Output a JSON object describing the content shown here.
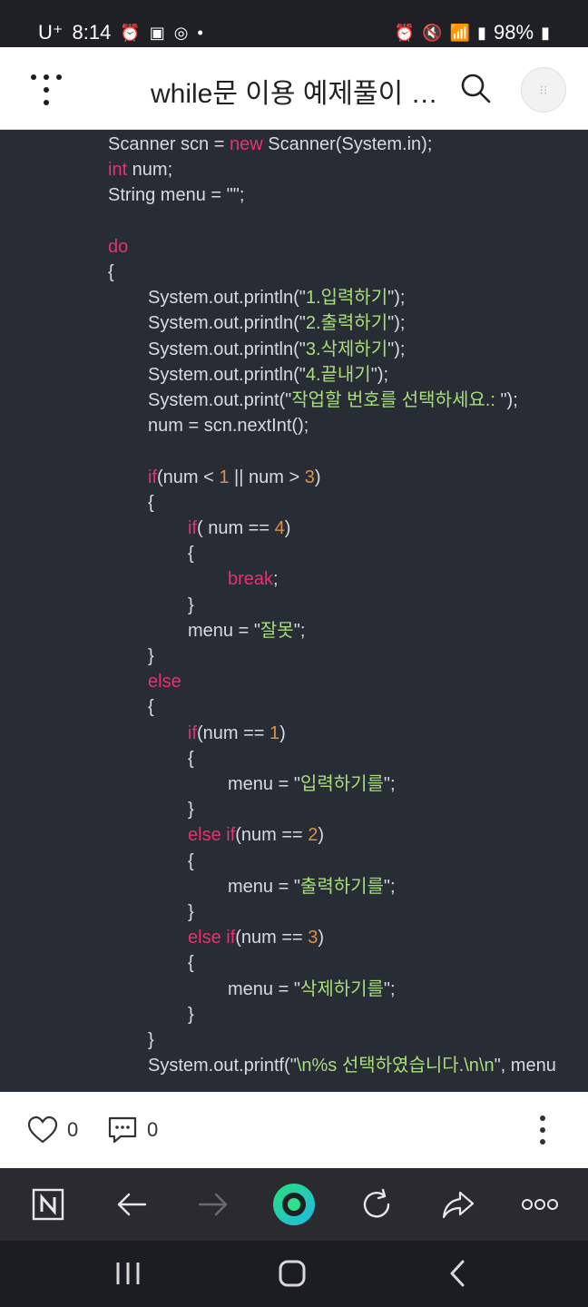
{
  "status_bar": {
    "carrier": "U⁺",
    "time": "8:14",
    "battery": "98%"
  },
  "header": {
    "title": "while문 이용 예제풀이 …"
  },
  "code_lines": [
    [
      [
        "plain",
        "Scanner scn = "
      ],
      [
        "kw",
        "new"
      ],
      [
        "plain",
        " Scanner(System.in);"
      ]
    ],
    [
      [
        "kw",
        "int"
      ],
      [
        "plain",
        " num;"
      ]
    ],
    [
      [
        "plain",
        "String menu = \"\";"
      ]
    ],
    [],
    [
      [
        "kw",
        "do"
      ]
    ],
    [
      [
        "plain",
        "{"
      ]
    ],
    [
      [
        "plain",
        "System.out.println(\""
      ],
      [
        "str",
        "1.입력하기"
      ],
      [
        "plain",
        "\");"
      ]
    ],
    [
      [
        "plain",
        "System.out.println(\""
      ],
      [
        "str",
        "2.출력하기"
      ],
      [
        "plain",
        "\");"
      ]
    ],
    [
      [
        "plain",
        "System.out.println(\""
      ],
      [
        "str",
        "3.삭제하기"
      ],
      [
        "plain",
        "\");"
      ]
    ],
    [
      [
        "plain",
        "System.out.println(\""
      ],
      [
        "str",
        "4.끝내기"
      ],
      [
        "plain",
        "\");"
      ]
    ],
    [
      [
        "plain",
        "System.out.print(\""
      ],
      [
        "str",
        "작업할 번호를 선택하세요.: "
      ],
      [
        "plain",
        "\");"
      ]
    ],
    [
      [
        "plain",
        "num = scn.nextInt();"
      ]
    ],
    [],
    [
      [
        "kw",
        "if"
      ],
      [
        "plain",
        "(num < "
      ],
      [
        "num",
        "1"
      ],
      [
        "plain",
        " || num > "
      ],
      [
        "num",
        "3"
      ],
      [
        "plain",
        ")"
      ]
    ],
    [
      [
        "plain",
        "{"
      ]
    ],
    [
      [
        "kw",
        "if"
      ],
      [
        "plain",
        "( num == "
      ],
      [
        "num",
        "4"
      ],
      [
        "plain",
        ")"
      ]
    ],
    [
      [
        "plain",
        "{"
      ]
    ],
    [
      [
        "kw",
        "break"
      ],
      [
        "plain",
        ";"
      ]
    ],
    [
      [
        "plain",
        "}"
      ]
    ],
    [
      [
        "plain",
        "menu = \""
      ],
      [
        "str",
        "잘못"
      ],
      [
        "plain",
        "\";"
      ]
    ],
    [
      [
        "plain",
        "}"
      ]
    ],
    [
      [
        "kw",
        "else"
      ]
    ],
    [
      [
        "plain",
        "{"
      ]
    ],
    [
      [
        "kw",
        "if"
      ],
      [
        "plain",
        "(num == "
      ],
      [
        "num",
        "1"
      ],
      [
        "plain",
        ")"
      ]
    ],
    [
      [
        "plain",
        "{"
      ]
    ],
    [
      [
        "plain",
        "menu = \""
      ],
      [
        "str",
        "입력하기를"
      ],
      [
        "plain",
        "\";"
      ]
    ],
    [
      [
        "plain",
        "}"
      ]
    ],
    [
      [
        "kw",
        "else if"
      ],
      [
        "plain",
        "(num == "
      ],
      [
        "num",
        "2"
      ],
      [
        "plain",
        ")"
      ]
    ],
    [
      [
        "plain",
        "{"
      ]
    ],
    [
      [
        "plain",
        "menu = \""
      ],
      [
        "str",
        "출력하기를"
      ],
      [
        "plain",
        "\";"
      ]
    ],
    [
      [
        "plain",
        "}"
      ]
    ],
    [
      [
        "kw",
        "else if"
      ],
      [
        "plain",
        "(num == "
      ],
      [
        "num",
        "3"
      ],
      [
        "plain",
        ")"
      ]
    ],
    [
      [
        "plain",
        "{"
      ]
    ],
    [
      [
        "plain",
        "menu = \""
      ],
      [
        "str",
        "삭제하기를"
      ],
      [
        "plain",
        "\";"
      ]
    ],
    [
      [
        "plain",
        "}"
      ]
    ],
    [
      [
        "plain",
        "}"
      ]
    ],
    [
      [
        "plain",
        "System.out.printf(\""
      ],
      [
        "str",
        "\\n%s 선택하였습니다.\\n\\n"
      ],
      [
        "plain",
        "\", menu"
      ]
    ]
  ],
  "actions": {
    "like_count": "0",
    "comment_count": "0"
  },
  "icons": [
    "menu-icon",
    "search-icon",
    "profile-icon",
    "heart-icon",
    "comment-icon",
    "more-icon",
    "naver-icon",
    "back-icon",
    "forward-icon",
    "home-icon",
    "reload-icon",
    "share-icon",
    "overflow-icon"
  ]
}
